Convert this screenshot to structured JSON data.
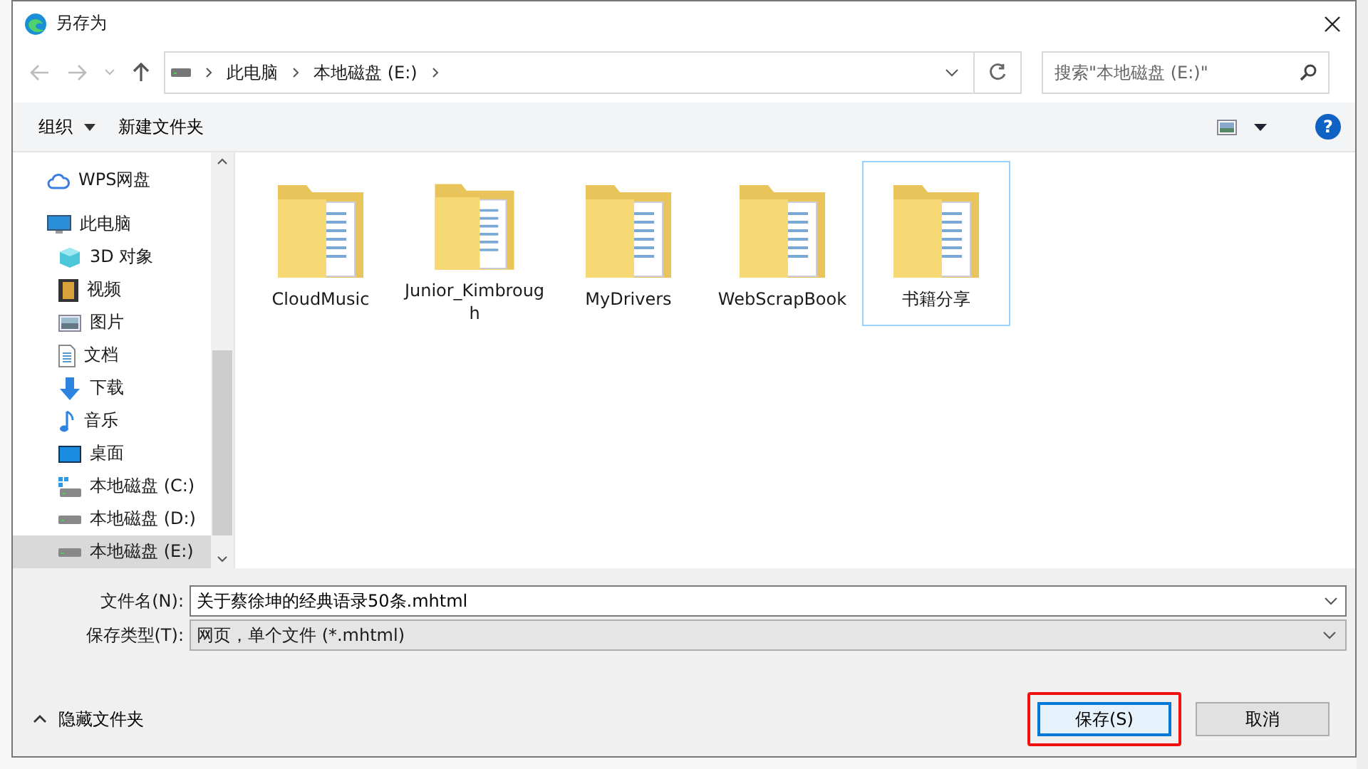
{
  "window": {
    "title": "另存为"
  },
  "address": {
    "crumbs": [
      "此电脑",
      "本地磁盘 (E:)"
    ]
  },
  "search": {
    "placeholder": "搜索\"本地磁盘 (E:)\""
  },
  "toolbar": {
    "organize": "组织",
    "new_folder": "新建文件夹",
    "help": "?"
  },
  "sidebar": {
    "items": [
      {
        "label": "WPS网盘",
        "kind": "cloud",
        "selected": false
      },
      {
        "label": "此电脑",
        "kind": "pc",
        "selected": false,
        "children": [
          {
            "label": "3D 对象",
            "kind": "cube",
            "selected": false
          },
          {
            "label": "视频",
            "kind": "video",
            "selected": false
          },
          {
            "label": "图片",
            "kind": "picture",
            "selected": false
          },
          {
            "label": "文档",
            "kind": "document",
            "selected": false
          },
          {
            "label": "下载",
            "kind": "download",
            "selected": false
          },
          {
            "label": "音乐",
            "kind": "music",
            "selected": false
          },
          {
            "label": "桌面",
            "kind": "desktop",
            "selected": false
          },
          {
            "label": "本地磁盘 (C:)",
            "kind": "sysdrive",
            "selected": false
          },
          {
            "label": "本地磁盘 (D:)",
            "kind": "drive",
            "selected": false
          },
          {
            "label": "本地磁盘 (E:)",
            "kind": "drive",
            "selected": true
          }
        ]
      }
    ]
  },
  "folders": [
    {
      "name": "CloudMusic",
      "selected": false
    },
    {
      "name": "Junior_Kimbrough",
      "selected": false
    },
    {
      "name": "MyDrivers",
      "selected": false
    },
    {
      "name": "WebScrapBook",
      "selected": false
    },
    {
      "name": "书籍分享",
      "selected": true
    }
  ],
  "form": {
    "file_name_label": "文件名(N):",
    "file_name": "关于蔡徐坤的经典语录50条.mhtml",
    "type_label": "保存类型(T):",
    "type": "网页，单个文件 (*.mhtml)"
  },
  "hide_folders": "隐藏文件夹",
  "buttons": [
    {
      "label": "保存(S)",
      "kind": "primary"
    },
    {
      "label": "取消",
      "kind": "normal"
    }
  ]
}
